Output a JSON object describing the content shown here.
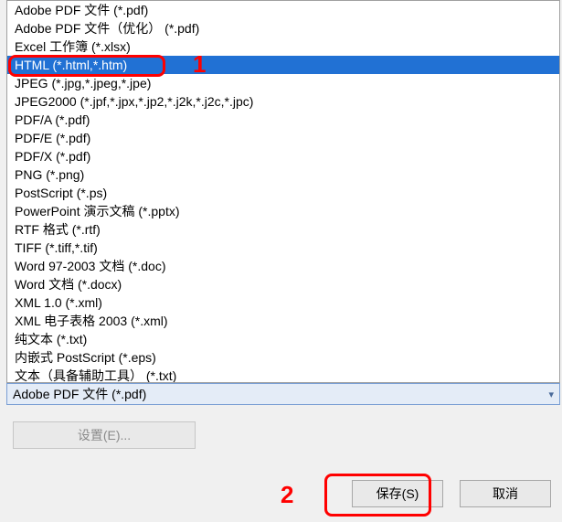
{
  "fileTypes": {
    "selectedIndex": 3,
    "items": [
      "Adobe PDF 文件 (*.pdf)",
      "Adobe PDF 文件（优化） (*.pdf)",
      "Excel 工作簿 (*.xlsx)",
      "HTML (*.html,*.htm)",
      "JPEG (*.jpg,*.jpeg,*.jpe)",
      "JPEG2000 (*.jpf,*.jpx,*.jp2,*.j2k,*.j2c,*.jpc)",
      "PDF/A (*.pdf)",
      "PDF/E (*.pdf)",
      "PDF/X (*.pdf)",
      "PNG (*.png)",
      "PostScript (*.ps)",
      "PowerPoint 演示文稿 (*.pptx)",
      "RTF 格式 (*.rtf)",
      "TIFF (*.tiff,*.tif)",
      "Word 97-2003 文档 (*.doc)",
      "Word 文档 (*.docx)",
      "XML 1.0 (*.xml)",
      "XML 电子表格 2003 (*.xml)",
      "纯文本 (*.txt)",
      "内嵌式 PostScript (*.eps)",
      "文本（具备辅助工具） (*.txt)"
    ]
  },
  "dropdown": {
    "selected": "Adobe PDF 文件 (*.pdf)"
  },
  "buttons": {
    "settings": "设置(E)...",
    "save": "保存(S)",
    "cancel": "取消"
  },
  "annotations": {
    "label1": "1",
    "label2": "2"
  }
}
